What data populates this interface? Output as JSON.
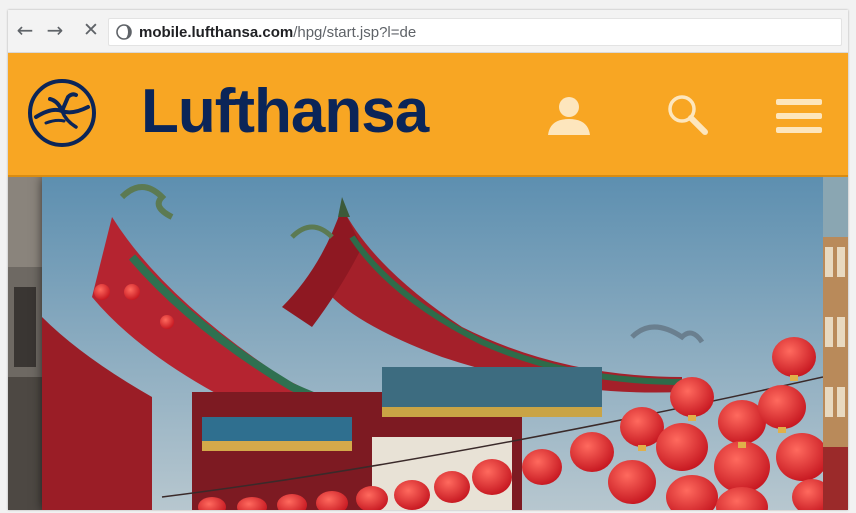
{
  "browser": {
    "back_icon": "arrow-left-icon",
    "forward_icon": "arrow-right-icon",
    "stop_icon": "close-icon",
    "url_host": "mobile.lufthansa.com",
    "url_path": "/hpg/start.jsp?l=de"
  },
  "header": {
    "brand": "Lufthansa",
    "logo_icon": "lufthansa-crane-logo",
    "icons": [
      "user-icon",
      "search-icon",
      "menu-icon"
    ],
    "colors": {
      "background": "#f8a623",
      "brand_text": "#0b2558",
      "icons": "#fde6bd"
    }
  },
  "hero": {
    "image_subject": "red chinese temple roof with hanging red lanterns",
    "peek_left": "dark photo edge",
    "peek_right": "building photo edge"
  }
}
